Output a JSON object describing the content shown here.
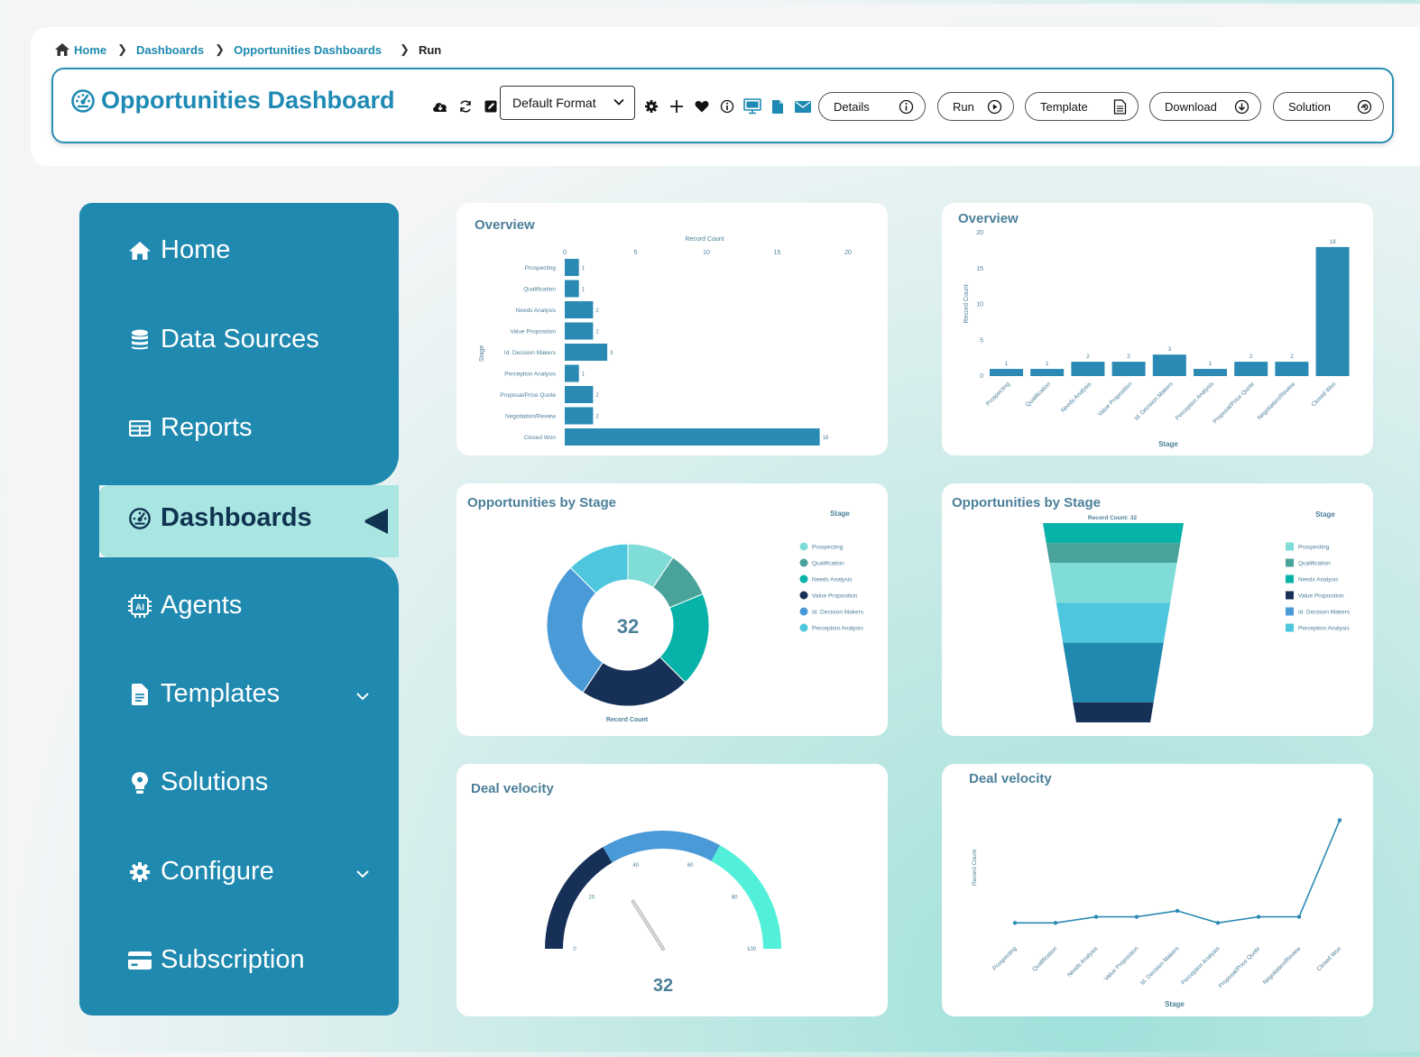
{
  "breadcrumb": {
    "home": "Home",
    "dashboards": "Dashboards",
    "opportunities": "Opportunities Dashboards",
    "current": "Run"
  },
  "header": {
    "title": "Opportunities Dashboard",
    "format_value": "Default Format",
    "buttons": {
      "details": "Details",
      "run": "Run",
      "template": "Template",
      "download": "Download",
      "solution": "Solution"
    }
  },
  "sidebar": {
    "items": [
      {
        "label": "Home",
        "icon": "home-icon"
      },
      {
        "label": "Data Sources",
        "icon": "database-icon"
      },
      {
        "label": "Reports",
        "icon": "table-icon"
      },
      {
        "label": "Dashboards",
        "icon": "dashboard-icon"
      },
      {
        "label": "Agents",
        "icon": "ai-chip-icon"
      },
      {
        "label": "Templates",
        "icon": "file-icon"
      },
      {
        "label": "Solutions",
        "icon": "lightbulb-icon"
      },
      {
        "label": "Configure",
        "icon": "gear-icon"
      },
      {
        "label": "Subscription",
        "icon": "credit-card-icon"
      }
    ]
  },
  "colors": {
    "brand": "#1f89b0",
    "active_bg": "#a9e6e2",
    "bar": "#2a8ab4"
  },
  "cards": {
    "overview_h_title": "Overview",
    "overview_v_title": "Overview",
    "donut_title": "Opportunities by Stage",
    "funnel_title": "Opportunities by Stage",
    "gauge_title": "Deal velocity",
    "line_title": "Deal velocity"
  },
  "chart_data": [
    {
      "type": "bar",
      "orientation": "horizontal",
      "title": "Overview",
      "xlabel": "Record Count",
      "ylabel": "Stage",
      "xlim": [
        0,
        20
      ],
      "xticks": [
        0,
        5,
        10,
        15,
        20
      ],
      "categories": [
        "Prospecting",
        "Qualification",
        "Needs Analysis",
        "Value Proposition",
        "Id. Decision Makers",
        "Perception Analysis",
        "Proposal/Price Quote",
        "Negotiation/Review",
        "Closed Won"
      ],
      "values": [
        1,
        1,
        2,
        2,
        3,
        1,
        2,
        2,
        18
      ]
    },
    {
      "type": "bar",
      "orientation": "vertical",
      "title": "Overview",
      "xlabel": "Stage",
      "ylabel": "Record Count",
      "ylim": [
        0,
        20
      ],
      "yticks": [
        0,
        5,
        10,
        15,
        20
      ],
      "categories": [
        "Prospecting",
        "Qualification",
        "Needs Analysis",
        "Value Proposition",
        "Id. Decision Makers",
        "Perception Analysis",
        "Proposal/Price Quote",
        "Negotiation/Review",
        "Closed Won"
      ],
      "values": [
        1,
        1,
        2,
        2,
        3,
        1,
        2,
        2,
        18
      ]
    },
    {
      "type": "pie",
      "variant": "donut",
      "title": "Opportunities by Stage",
      "center_value": "32",
      "xlabel": "Record Count",
      "legend_title": "Stage",
      "legend": [
        "Prospecting",
        "Qualification",
        "Needs Analysis",
        "Value Proposition",
        "Id. Decision Makers",
        "Perception Analysis"
      ],
      "slices": [
        {
          "label": "Prospecting",
          "value": 3,
          "color": "#7fdcd6"
        },
        {
          "label": "Qualification",
          "value": 3,
          "color": "#4aa39b"
        },
        {
          "label": "Needs Analysis",
          "value": 6,
          "color": "#07b3a8"
        },
        {
          "label": "Value Proposition",
          "value": 7,
          "color": "#173058"
        },
        {
          "label": "Id. Decision Makers",
          "value": 9,
          "color": "#4a9ad8"
        },
        {
          "label": "Perception Analysis",
          "value": 4,
          "color": "#4ec7de"
        }
      ]
    },
    {
      "type": "funnel",
      "title": "Opportunities by Stage",
      "subtitle": "Record Count: 32",
      "legend_title": "Stage",
      "legend": [
        "Prospecting",
        "Qualification",
        "Needs Analysis",
        "Value Proposition",
        "Id. Decision Makers",
        "Perception Analysis"
      ],
      "segments": [
        {
          "value": 2,
          "color": "#07b3a8"
        },
        {
          "value": 2,
          "color": "#4aa39b"
        },
        {
          "value": 4,
          "color": "#7fdcd6"
        },
        {
          "value": 4,
          "color": "#4ec7de"
        },
        {
          "value": 6,
          "color": "#1f89b0"
        },
        {
          "value": 2,
          "color": "#173058"
        }
      ]
    },
    {
      "type": "gauge",
      "title": "Deal velocity",
      "value": 32,
      "range": [
        0,
        100
      ],
      "ticks": [
        0,
        20,
        40,
        60,
        80,
        100
      ],
      "bands": [
        {
          "from": 0,
          "to": 33,
          "color": "#173058"
        },
        {
          "from": 33,
          "to": 66,
          "color": "#4a9ad8"
        },
        {
          "from": 66,
          "to": 100,
          "color": "#52f0d8"
        }
      ]
    },
    {
      "type": "line",
      "title": "Deal velocity",
      "xlabel": "Stage",
      "ylabel": "Record Count",
      "ylim": [
        0,
        20
      ],
      "categories": [
        "Prospecting",
        "Qualification",
        "Needs Analysis",
        "Value Proposition",
        "Id. Decision Makers",
        "Perception Analysis",
        "Proposal/Price Quote",
        "Negotiation/Review",
        "Closed Won"
      ],
      "values": [
        1,
        1,
        2,
        2,
        3,
        1,
        2,
        2,
        18
      ]
    }
  ]
}
